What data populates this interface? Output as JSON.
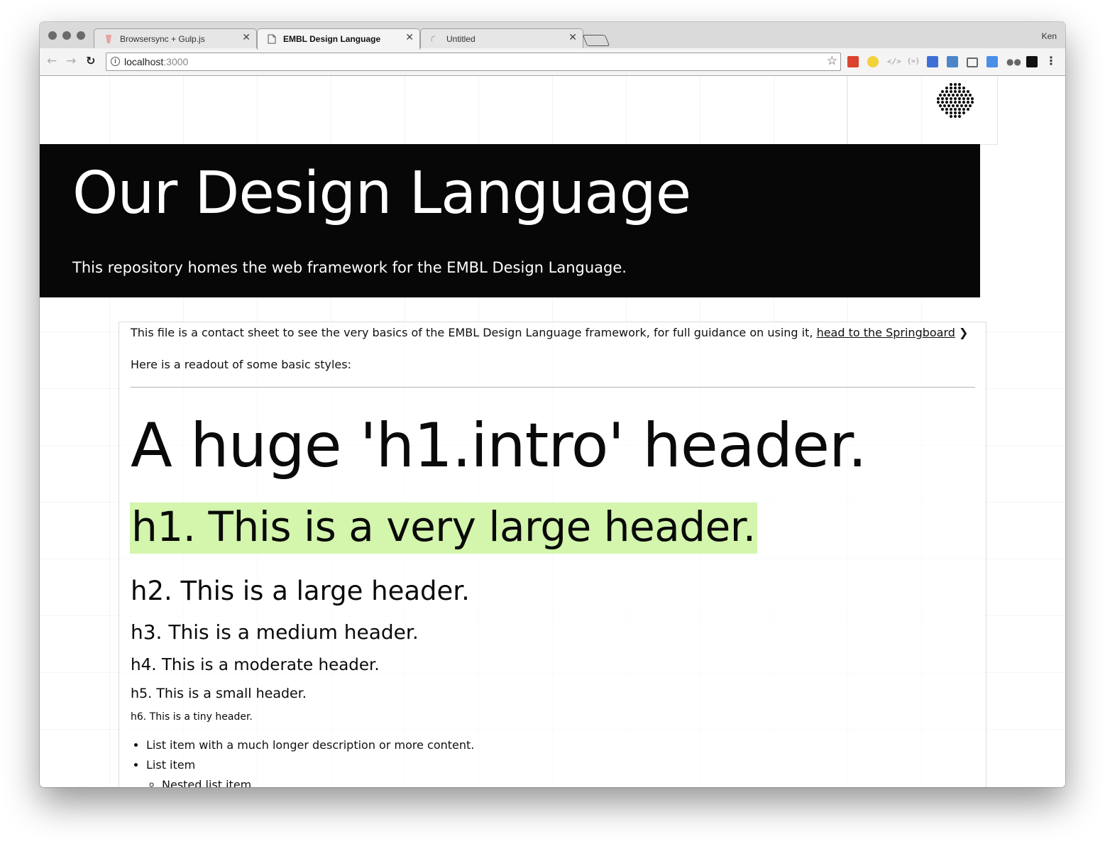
{
  "browser": {
    "tabs": [
      {
        "title": "Browsersync + Gulp.js",
        "active": false,
        "favicon": "gulp-icon"
      },
      {
        "title": "EMBL Design Language",
        "active": true,
        "favicon": "document-icon"
      },
      {
        "title": "Untitled",
        "active": false,
        "favicon": "loading-spinner-icon"
      }
    ],
    "close_glyph": "✕",
    "profile_name": "Ken",
    "url_host": "localhost",
    "url_port": ":3000",
    "colors": {
      "chrome": "#dadada",
      "toolbar": "#f4f4f4"
    }
  },
  "page": {
    "masthead": {
      "title": "Our Design Language",
      "subtitle": "This repository homes the web framework for the EMBL Design Language."
    },
    "intro_text": "This file is a contact sheet to see the very basics of the EMBL Design Language framework, for full guidance on using it, ",
    "intro_link": "head to the Springboard",
    "readout_text": "Here is a readout of some basic styles:",
    "headers": {
      "intro": "A huge 'h1.intro' header.",
      "h1": "h1. This is a very large header.",
      "h2": "h2. This is a large header.",
      "h3": "h3. This is a medium header.",
      "h4": "h4. This is a moderate header.",
      "h5": "h5. This is a small header.",
      "h6": "h6. This is a tiny header."
    },
    "list": {
      "item1": "List item with a much longer description or more content.",
      "item2": "List item",
      "nested1": "Nested list item"
    },
    "colors": {
      "masthead_bg": "#070707",
      "h1_highlight": "#d3f5ac"
    }
  }
}
